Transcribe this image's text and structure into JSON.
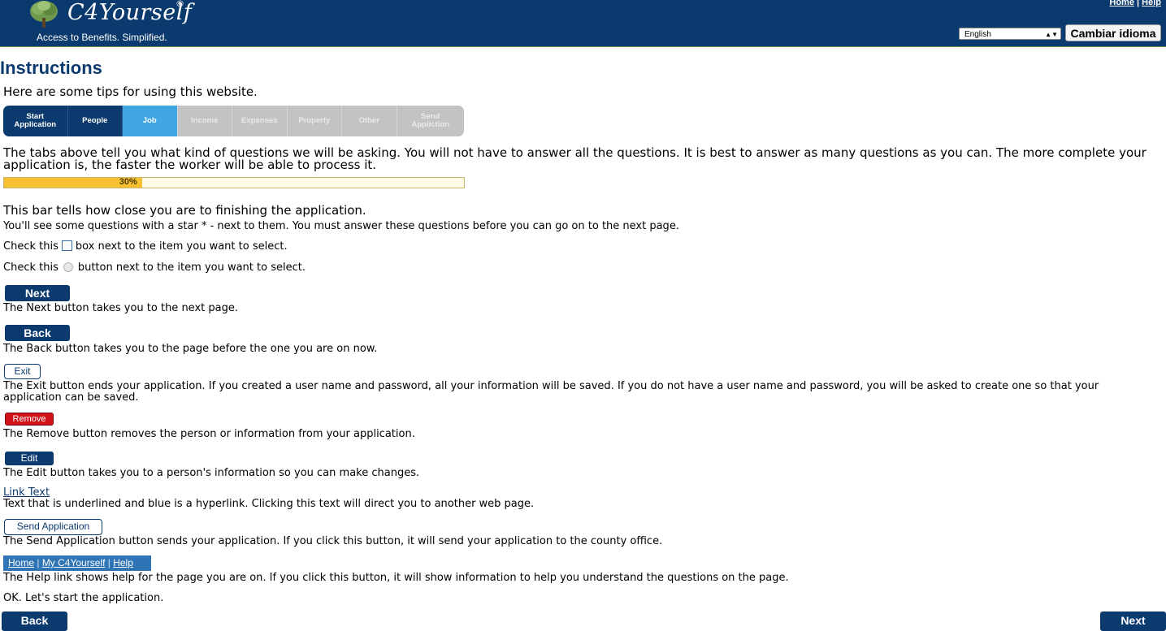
{
  "header": {
    "logo_text": "C4Yourself",
    "logo_mark": "®",
    "tagline": "Access to Benefits.  Simplified.",
    "links": {
      "home": "Home",
      "sep": "|",
      "help": "Help"
    },
    "language": {
      "selected": "English",
      "button": "Cambiar idioma"
    }
  },
  "page": {
    "title": "Instructions",
    "intro": "Here are some tips for using this website.",
    "tabs": [
      {
        "label": "Start Application",
        "state": "done"
      },
      {
        "label": "People",
        "state": "done"
      },
      {
        "label": "Job",
        "state": "current"
      },
      {
        "label": "Income",
        "state": "todo"
      },
      {
        "label": "Expenses",
        "state": "todo"
      },
      {
        "label": "Property",
        "state": "todo"
      },
      {
        "label": "Other",
        "state": "todo"
      },
      {
        "label": "Send Appliction",
        "state": "todo"
      }
    ],
    "tabs_desc_1": "The tabs above tell you what kind of questions we will be asking. You will not have to answer all the questions. It is best to answer as many questions as you can. The more complete your",
    "tabs_desc_2": "application is, the faster the worker will be able to process it.",
    "progress": {
      "percent": 30,
      "label": "30%"
    },
    "progress_desc": "This bar tells how close you are to finishing the application.",
    "star_desc": "You'll see some questions with a star * - next to them. You must answer these questions before you can go on to the next page.",
    "checkbox_pre": "Check this",
    "checkbox_post": "box next to the item you want to select.",
    "radio_pre": "Check this",
    "radio_post": "button next to the item you want to select.",
    "next_label": "Next",
    "next_desc": "The Next button takes you to the next page.",
    "back_label": "Back",
    "back_desc": "The Back button takes you to the page before the one you are on now.",
    "exit_label": "Exit",
    "exit_desc_1": "The Exit button ends your application. If you created a user name and password, all your information will be saved. If you do not have a user name and password, you will be asked to create one so that your",
    "exit_desc_2": "application can be saved.",
    "remove_label": "Remove",
    "remove_desc": "The Remove button removes the person or information from your application.",
    "edit_label": "Edit",
    "edit_desc": "The Edit button takes you to a person's information so you can make changes.",
    "link_label": "Link Text",
    "link_desc": "Text that is underlined and blue is a hyperlink. Clicking this text will direct you to another web page.",
    "send_label": "Send Application",
    "send_desc": "The Send Application button sends your application. If you click this button, it will send your application to the county office.",
    "navbar": {
      "home": "Home",
      "my": "My C4Yourself",
      "help": "Help"
    },
    "help_desc": "The Help link shows help for the page you are on. If you click this button, it will show information to help you understand the questions on the page.",
    "ok_text": "OK. Let's start the application.",
    "footer_back": "Back",
    "footer_next": "Next"
  },
  "colors": {
    "navy": "#0b3a6e",
    "current_tab": "#41a6e1",
    "progress_fill": "#f7c132",
    "remove_red": "#d2121a"
  }
}
